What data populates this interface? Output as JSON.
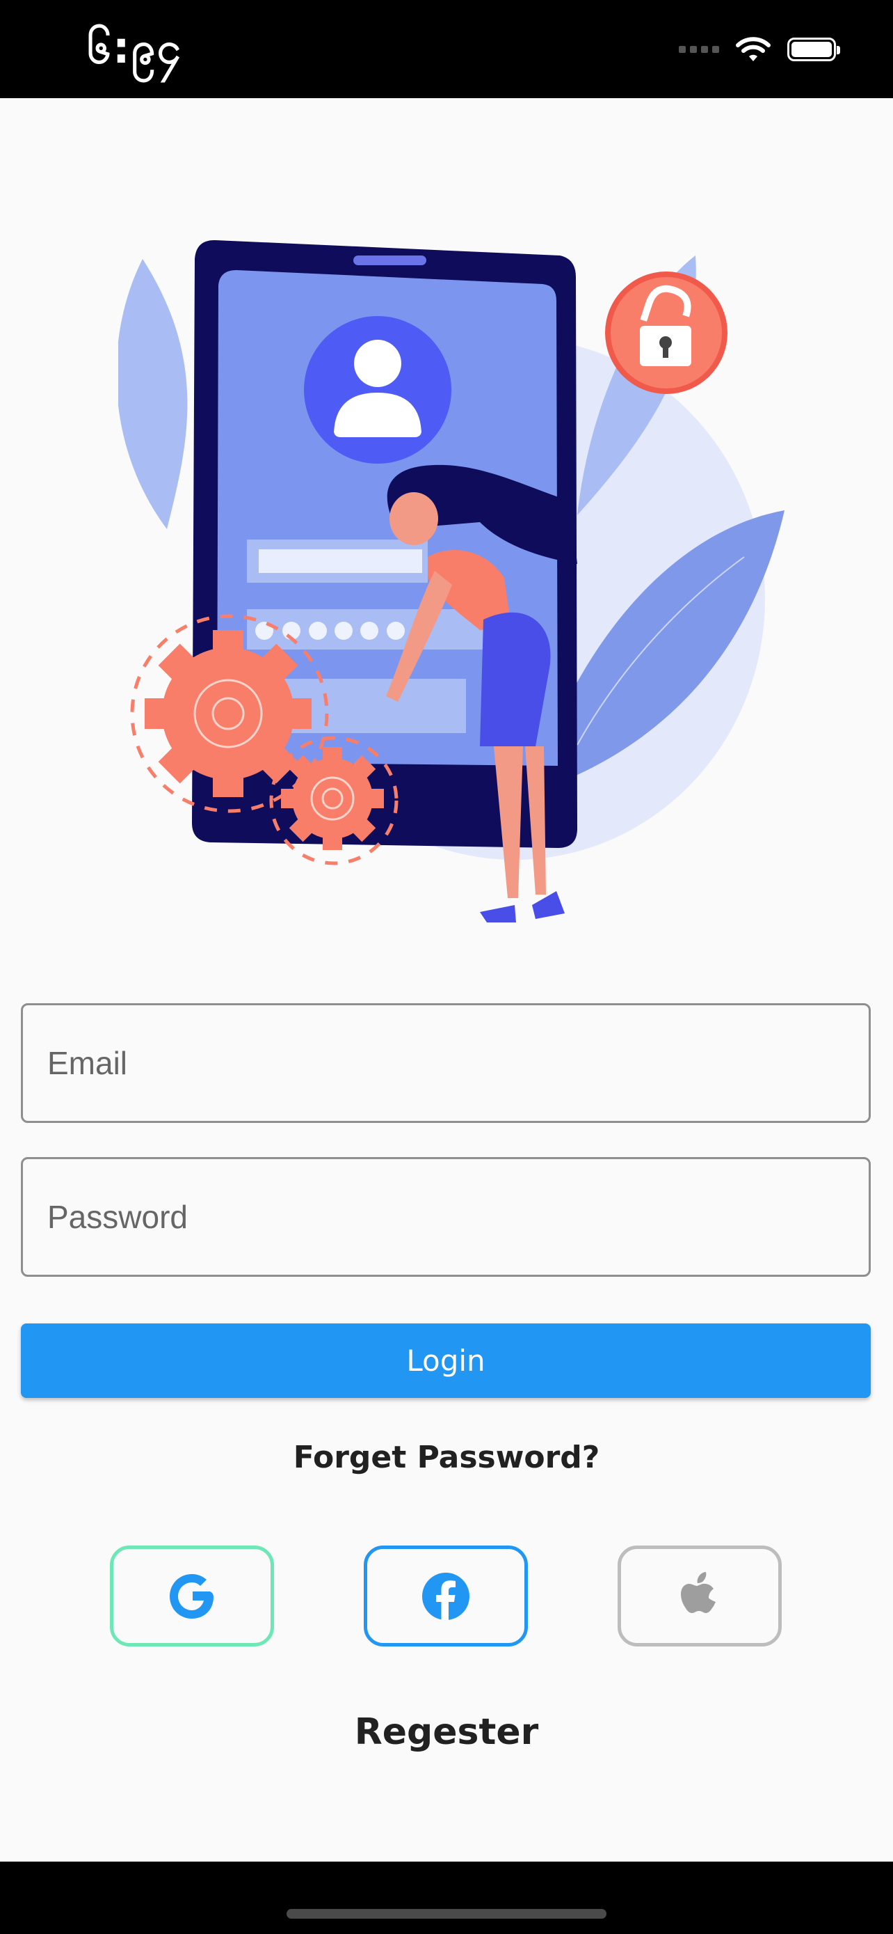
{
  "status_bar": {
    "time": "၆:၉၄"
  },
  "form": {
    "email_placeholder": "Email",
    "password_placeholder": "Password",
    "login_label": "Login",
    "forget_label": "Forget Password?"
  },
  "social": [
    {
      "provider": "Google",
      "icon": "google-icon",
      "color": "#6ee7b7"
    },
    {
      "provider": "Facebook",
      "icon": "facebook-icon",
      "color": "#2196f3"
    },
    {
      "provider": "Apple",
      "icon": "apple-icon",
      "color": "#bdbdbd"
    }
  ],
  "register_label": "Regester",
  "colors": {
    "primary": "#2196f3",
    "illustration_navy": "#0f0c5c",
    "illustration_coral": "#f87e6a"
  }
}
